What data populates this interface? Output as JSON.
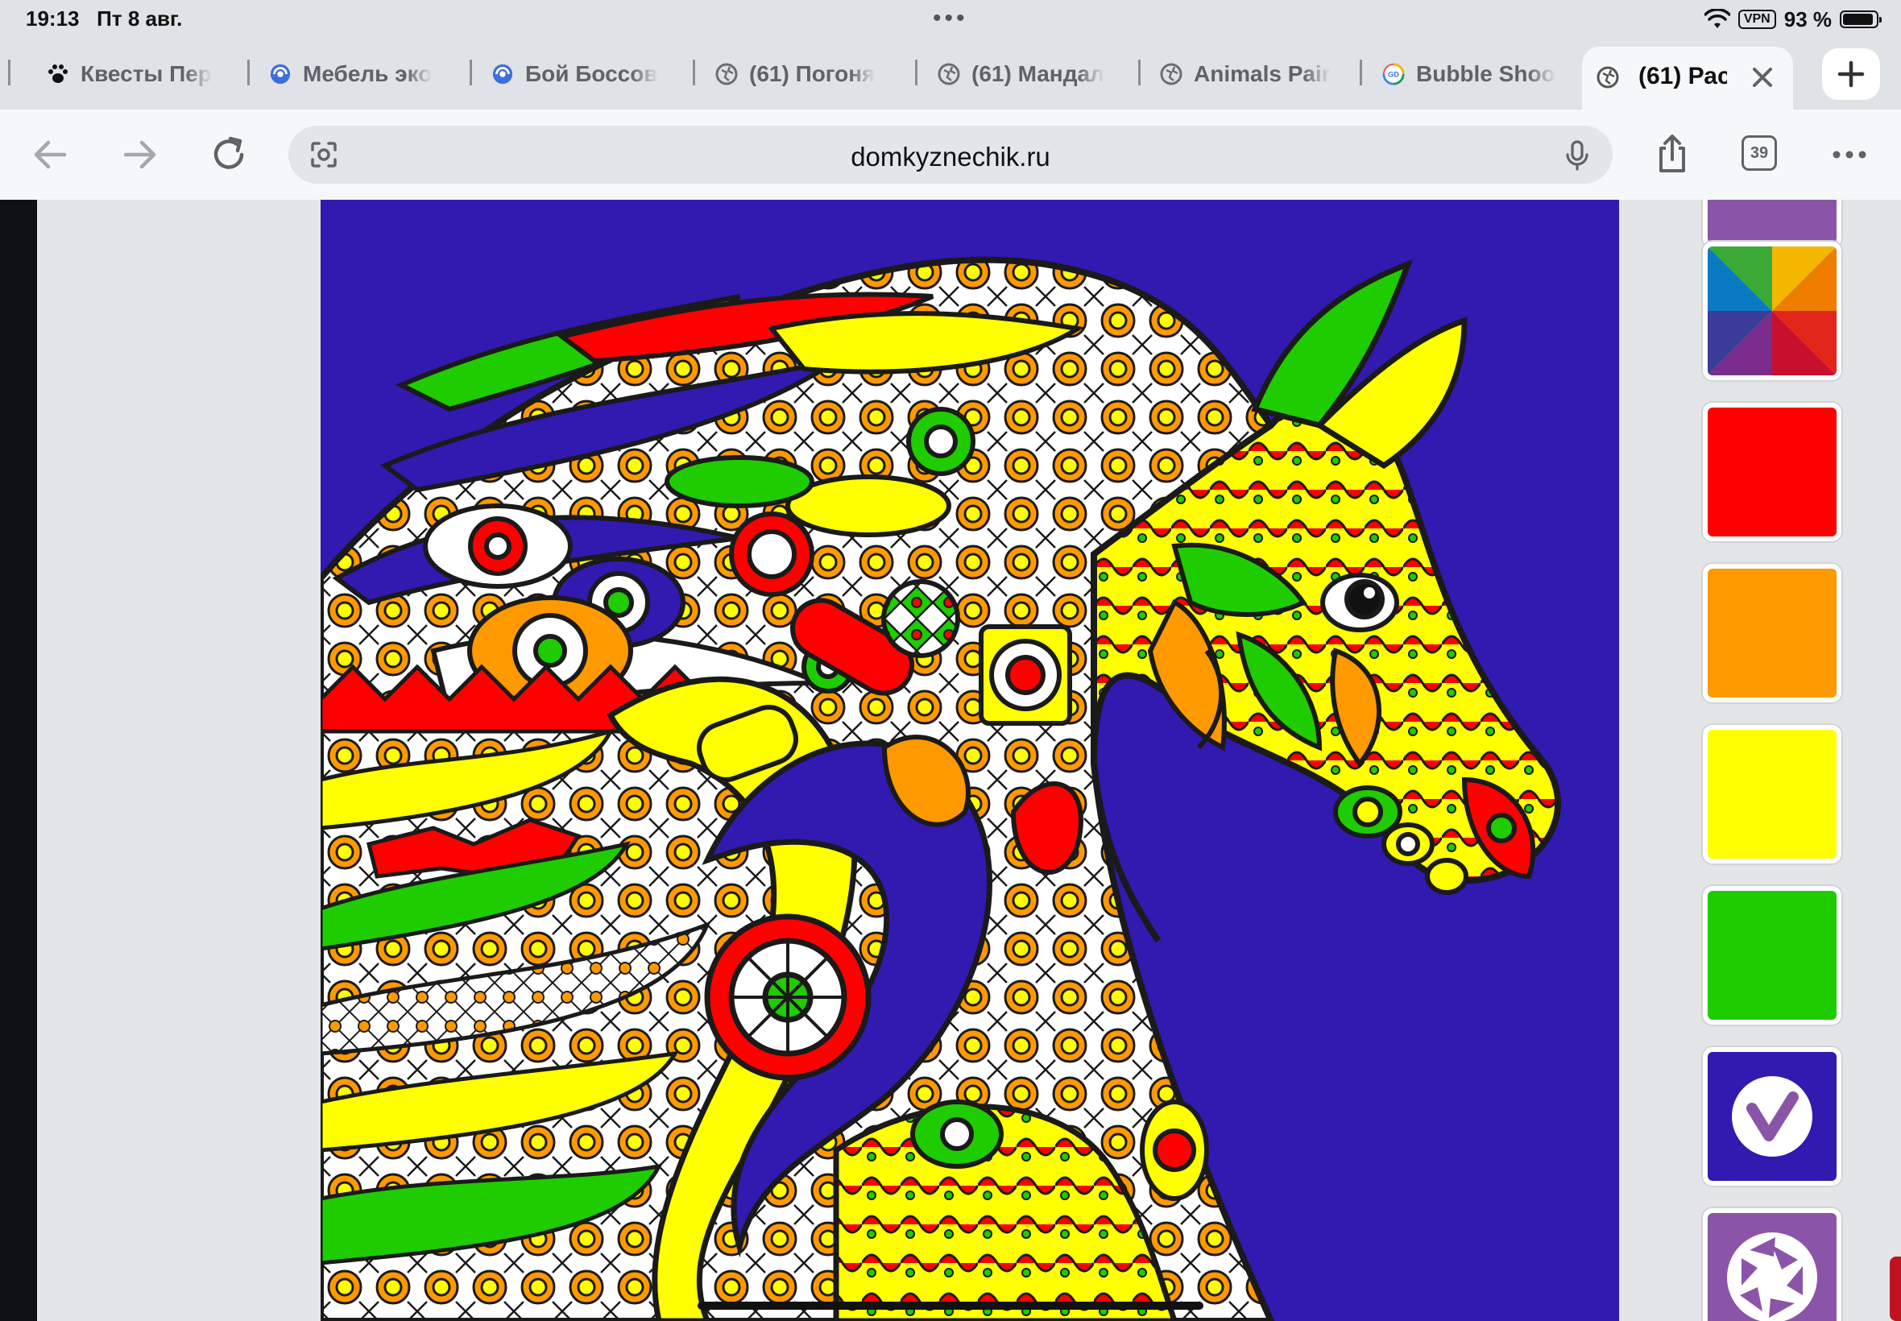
{
  "status_bar": {
    "time": "19:13",
    "date": "Пт 8 авг.",
    "vpn": "VPN",
    "battery": "93 %",
    "battery_level": 0.93
  },
  "tabs": [
    {
      "title": "Квесты Пер",
      "icon": "paw-icon"
    },
    {
      "title": "Мебель эко",
      "icon": "globe-blue-icon"
    },
    {
      "title": "Бой Боссов",
      "icon": "globe-blue-icon"
    },
    {
      "title": "(61) Погоня",
      "icon": "globe-icon"
    },
    {
      "title": "(61) Мандал",
      "icon": "globe-icon"
    },
    {
      "title": "Animals Pair",
      "icon": "globe-icon"
    },
    {
      "title": "Bubble Shoo",
      "icon": "gd-icon"
    }
  ],
  "active_tab": {
    "title": "(61) Рас",
    "icon": "globe-icon"
  },
  "toolbar": {
    "url": "domkyznechik.ru",
    "tab_count": "39"
  },
  "palette": {
    "colors": [
      "#8a55a8",
      "rainbow",
      "#ff0000",
      "#ff9900",
      "#ffff00",
      "#1ecc00",
      "#3219b0",
      "#8a55a8"
    ],
    "selected_index": 6,
    "tools": [
      "color-wheel-icon",
      "camera-aperture-icon"
    ]
  }
}
